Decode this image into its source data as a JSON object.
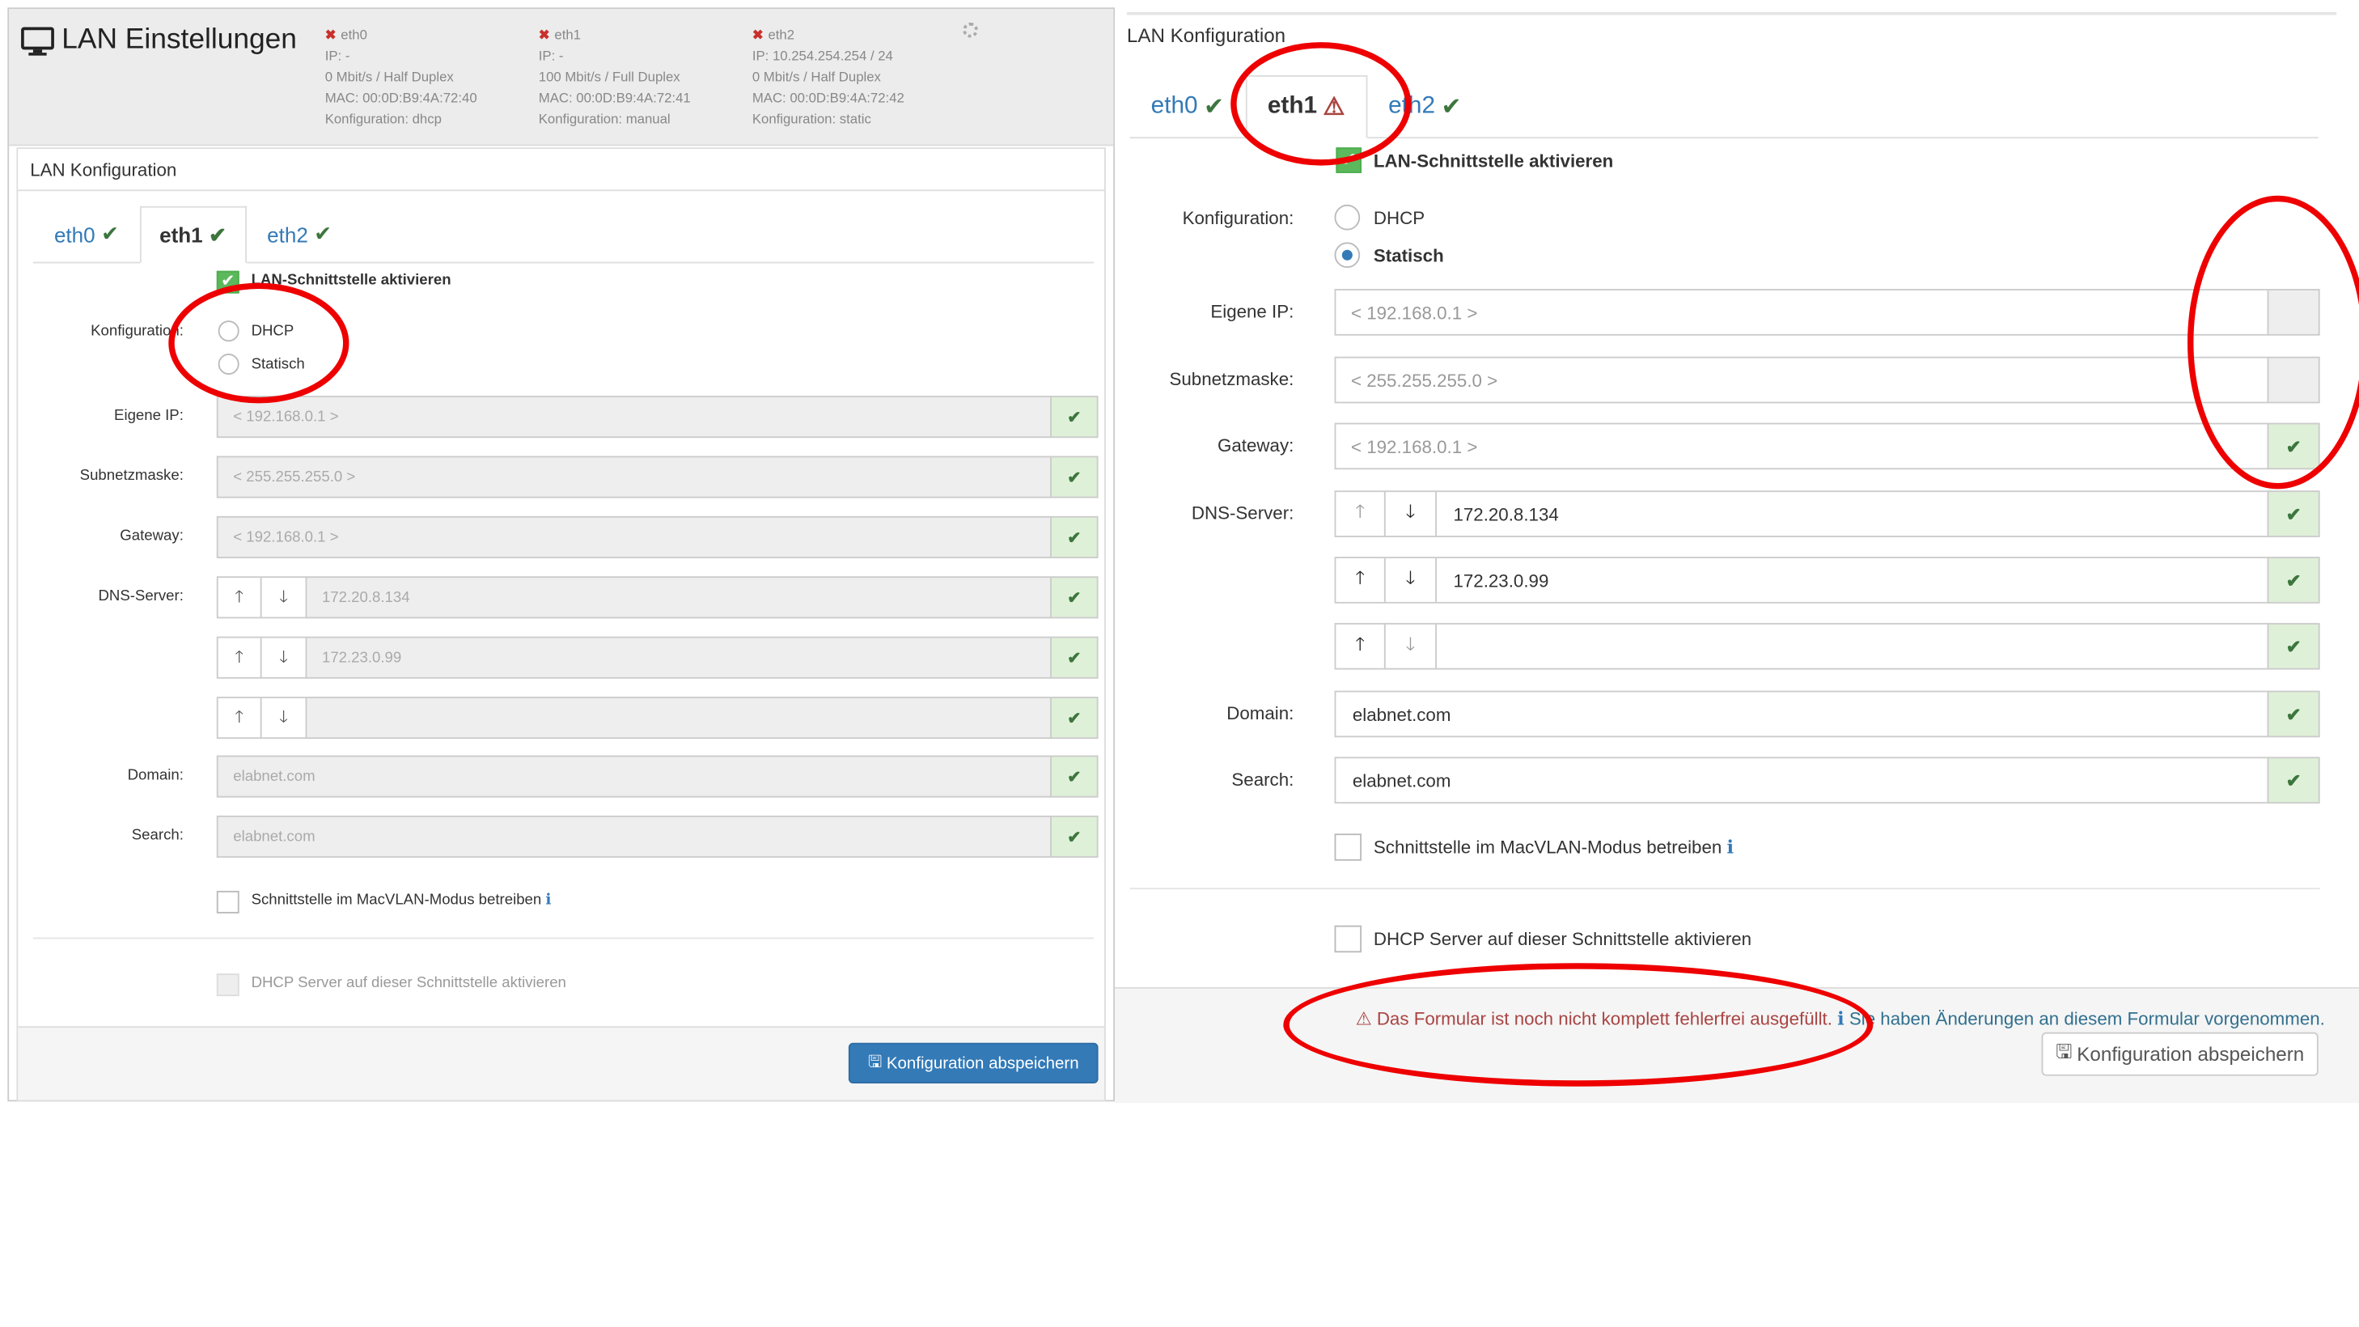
{
  "left": {
    "title": "LAN Einstellungen",
    "interfaces": [
      {
        "name": "eth0",
        "ip": "IP: -",
        "speed": "0 Mbit/s / Half Duplex",
        "mac": "MAC: 00:0D:B9:4A:72:40",
        "config": "Konfiguration: dhcp"
      },
      {
        "name": "eth1",
        "ip": "IP: -",
        "speed": "100 Mbit/s / Full Duplex",
        "mac": "MAC: 00:0D:B9:4A:72:41",
        "config": "Konfiguration: manual"
      },
      {
        "name": "eth2",
        "ip": "IP: 10.254.254.254 / 24",
        "speed": "0 Mbit/s / Half Duplex",
        "mac": "MAC: 00:0D:B9:4A:72:42",
        "config": "Konfiguration: static"
      }
    ],
    "panel_title": "LAN Konfiguration",
    "tabs": [
      "eth0",
      "eth1",
      "eth2"
    ],
    "activate": "LAN-Schnittstelle aktivieren",
    "labels": {
      "konfig": "Konfiguration:",
      "ip": "Eigene IP:",
      "mask": "Subnetzmaske:",
      "gw": "Gateway:",
      "dns": "DNS-Server:",
      "domain": "Domain:",
      "search": "Search:"
    },
    "radio": {
      "dhcp": "DHCP",
      "static": "Statisch"
    },
    "placeholders": {
      "ip": "< 192.168.0.1 >",
      "mask": "< 255.255.255.0 >",
      "gw": "< 192.168.0.1 >"
    },
    "dns": [
      "172.20.8.134",
      "172.23.0.99",
      ""
    ],
    "domain": "elabnet.com",
    "search": "elabnet.com",
    "macvlan": "Schnittstelle im MacVLAN-Modus betreiben",
    "dhcpserver": "DHCP Server auf dieser Schnittstelle aktivieren",
    "save": "Konfiguration abspeichern"
  },
  "right": {
    "panel_title": "LAN Konfiguration",
    "tabs": [
      "eth0",
      "eth1",
      "eth2"
    ],
    "activate": "LAN-Schnittstelle aktivieren",
    "labels": {
      "konfig": "Konfiguration:",
      "ip": "Eigene IP:",
      "mask": "Subnetzmaske:",
      "gw": "Gateway:",
      "dns": "DNS-Server:",
      "domain": "Domain:",
      "search": "Search:"
    },
    "radio": {
      "dhcp": "DHCP",
      "static": "Statisch"
    },
    "placeholders": {
      "ip": "< 192.168.0.1 >",
      "mask": "< 255.255.255.0 >",
      "gw": "< 192.168.0.1 >"
    },
    "dns": [
      "172.20.8.134",
      "172.23.0.99",
      ""
    ],
    "domain": "elabnet.com",
    "search": "elabnet.com",
    "macvlan": "Schnittstelle im MacVLAN-Modus betreiben",
    "dhcpserver": "DHCP Server auf dieser Schnittstelle aktivieren",
    "error": "Das Formular ist noch nicht komplett fehlerfrei ausgefüllt.",
    "info": "Sie haben Änderungen an diesem Formular vorgenommen.",
    "save": "Konfiguration abspeichern"
  },
  "colors": {
    "accent": "#337ab7",
    "success": "#3c763d",
    "error": "#a94442",
    "annotation": "#e00000"
  }
}
